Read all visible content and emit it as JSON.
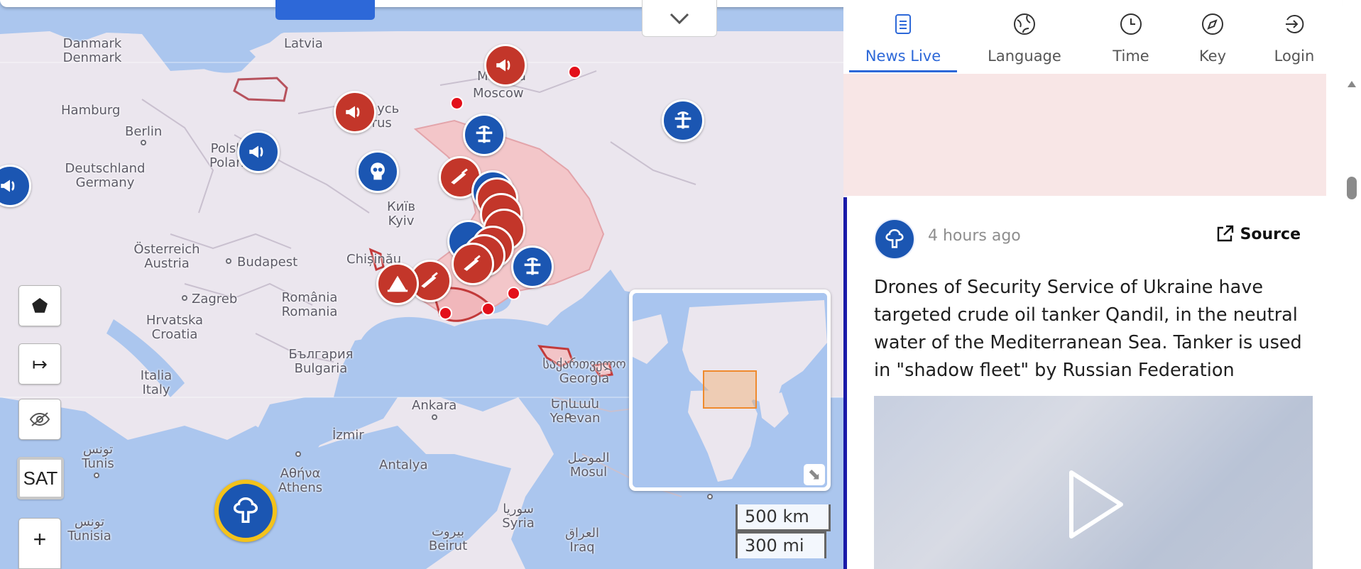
{
  "map": {
    "labels": {
      "danmark": "Danmark\nDenmark",
      "latvia": "Latvia",
      "moscow": "Moscow",
      "moskva": "Москва",
      "hamburg": "Hamburg",
      "berlin": "Berlin",
      "deutschland": "Deutschland\nGermany",
      "polska": "Polska\nPoland",
      "belarus": "Беларусь\nBelarus",
      "kyiv": "Київ\nKyiv",
      "osterreich": "Österreich\nAustria",
      "budapest": "Budapest",
      "chisinau": "Chișinău",
      "zagreb": "Zagreb",
      "romania": "România\nRomania",
      "hrvatska": "Hrvatska\nCroatia",
      "bulgaria": "България\nBulgaria",
      "italia": "Italia\nItaly",
      "ankara": "Ankara",
      "izmir": "İzmir",
      "athens": "Αθήνα\nAthens",
      "antalya": "Antalya",
      "tunis": "تونس\nTunis",
      "tunisia": "تونس\nTunisia",
      "yerevan": "Երևան\nYerevan",
      "georgia": "საქართველო\nGeorgia",
      "mosul": "الموصل\nMosul",
      "syria": "سوريا\nSyria",
      "beirut": "بيروت\nBeirut",
      "iraq": "العراق\nIraq"
    },
    "controls": {
      "polygon_tool": "⬟",
      "arrow_tool": "↦",
      "hide_tool": "eye-off",
      "sat_label": "SAT",
      "zoom_in": "+"
    },
    "scale": {
      "km": "500 km",
      "mi": "300 mi"
    },
    "colors": {
      "water": "#abc6ee",
      "land": "#ebe6ee",
      "occupied": "#f3c6c9",
      "marker_red": "#c3362a",
      "marker_blue": "#1b56b2",
      "dot_red": "#e3101a",
      "accent": "#2d68d8"
    }
  },
  "panel": {
    "tabs": [
      {
        "label": "News Live",
        "icon": "document-icon",
        "active": true
      },
      {
        "label": "Language",
        "icon": "globe-icon",
        "active": false
      },
      {
        "label": "Time",
        "icon": "clock-icon",
        "active": false
      },
      {
        "label": "Key",
        "icon": "compass-icon",
        "active": false
      },
      {
        "label": "Login",
        "icon": "login-icon",
        "active": false
      }
    ],
    "post": {
      "time_ago": "4 hours ago",
      "source_label": "Source",
      "headline": "Drones of Security Service of Ukraine have targeted crude oil tanker Qandil, in the neutral water of the Mediterranean Sea. Tanker is used in \"shadow fleet\" by Russian Federation",
      "avatar_icon": "explosion-icon"
    }
  }
}
